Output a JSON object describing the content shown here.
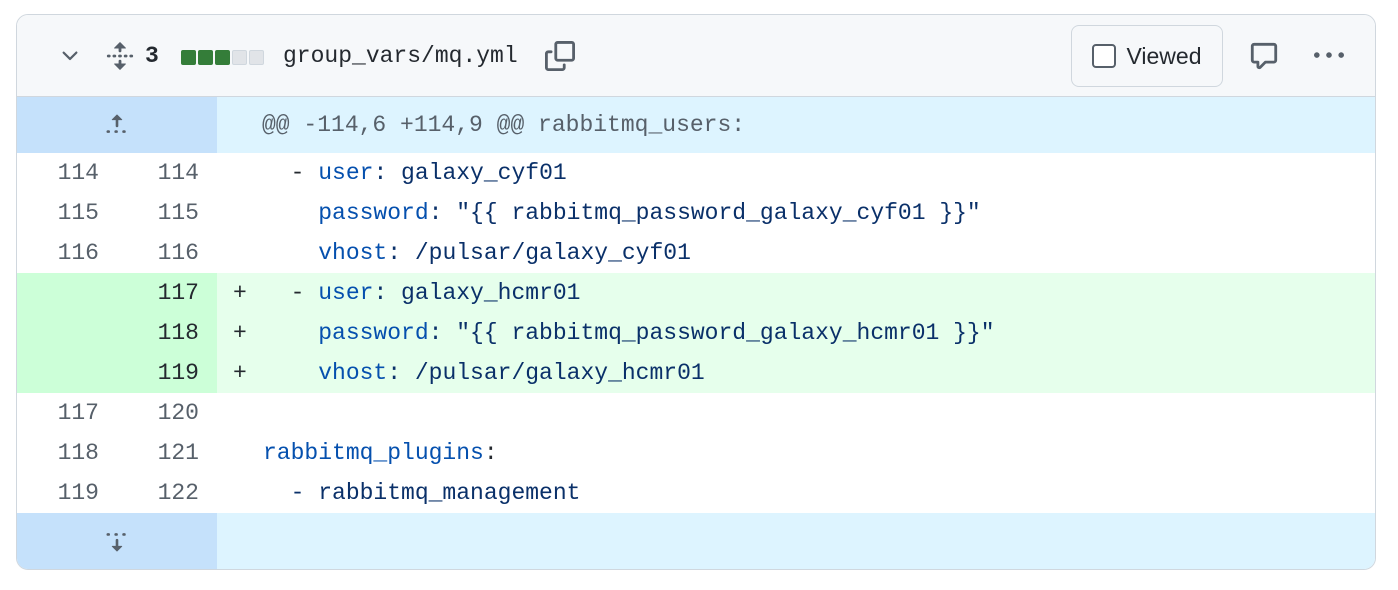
{
  "file_header": {
    "change_count": "3",
    "diffstat": {
      "added": 3,
      "deleted": 0,
      "neutral": 2
    },
    "file_path": "group_vars/mq.yml",
    "viewed_label": "Viewed",
    "viewed_checked": false,
    "icons": {
      "collapse": "chevron-down-icon",
      "expand_all": "unfold-icon",
      "copy": "copy-icon",
      "comment": "comment-icon",
      "more": "kebab-horizontal-icon"
    }
  },
  "hunk": {
    "header": "@@ -114,6 +114,9 @@ rabbitmq_users:",
    "expand_up_icon": "expand-up-icon",
    "expand_down_icon": "expand-down-icon"
  },
  "lines": [
    {
      "type": "context",
      "old": "114",
      "new": "114",
      "marker": "",
      "tokens": [
        {
          "t": "  - ",
          "c": "plain"
        },
        {
          "t": "user",
          "c": "key"
        },
        {
          "t": ": galaxy_cyf01",
          "c": "str"
        }
      ]
    },
    {
      "type": "context",
      "old": "115",
      "new": "115",
      "marker": "",
      "tokens": [
        {
          "t": "    ",
          "c": "plain"
        },
        {
          "t": "password",
          "c": "key"
        },
        {
          "t": ": \"{{ rabbitmq_password_galaxy_cyf01 }}\"",
          "c": "str"
        }
      ]
    },
    {
      "type": "context",
      "old": "116",
      "new": "116",
      "marker": "",
      "tokens": [
        {
          "t": "    ",
          "c": "plain"
        },
        {
          "t": "vhost",
          "c": "key"
        },
        {
          "t": ": /pulsar/galaxy_cyf01",
          "c": "str"
        }
      ]
    },
    {
      "type": "add",
      "old": "",
      "new": "117",
      "marker": "+",
      "tokens": [
        {
          "t": "  - ",
          "c": "plain"
        },
        {
          "t": "user",
          "c": "key"
        },
        {
          "t": ": galaxy_hcmr01",
          "c": "str"
        }
      ]
    },
    {
      "type": "add",
      "old": "",
      "new": "118",
      "marker": "+",
      "tokens": [
        {
          "t": "    ",
          "c": "plain"
        },
        {
          "t": "password",
          "c": "key"
        },
        {
          "t": ": \"{{ rabbitmq_password_galaxy_hcmr01 }}\"",
          "c": "str"
        }
      ]
    },
    {
      "type": "add",
      "old": "",
      "new": "119",
      "marker": "+",
      "tokens": [
        {
          "t": "    ",
          "c": "plain"
        },
        {
          "t": "vhost",
          "c": "key"
        },
        {
          "t": ": /pulsar/galaxy_hcmr01",
          "c": "str"
        }
      ]
    },
    {
      "type": "context",
      "old": "117",
      "new": "120",
      "marker": "",
      "tokens": []
    },
    {
      "type": "context",
      "old": "118",
      "new": "121",
      "marker": "",
      "tokens": [
        {
          "t": "rabbitmq_plugins",
          "c": "key"
        },
        {
          "t": ":",
          "c": "plain"
        }
      ]
    },
    {
      "type": "context",
      "old": "119",
      "new": "122",
      "marker": "",
      "tokens": [
        {
          "t": "  - rabbitmq_management",
          "c": "str"
        }
      ]
    }
  ],
  "colors": {
    "addition_bg": "#e6ffec",
    "addition_gutter": "#ccffd8",
    "hunk_bg": "#ddf4ff",
    "diffstat_added": "#347d39"
  }
}
